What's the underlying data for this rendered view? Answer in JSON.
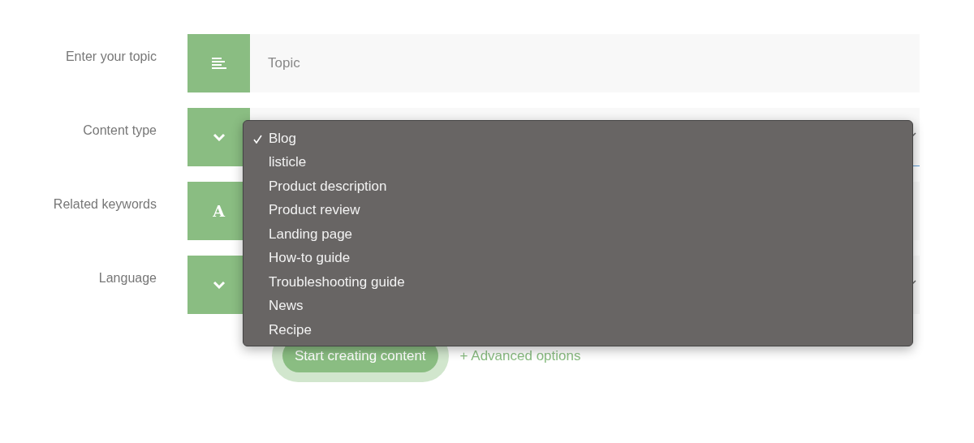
{
  "form": {
    "rows": [
      {
        "label": "Enter your topic",
        "kind": "text",
        "placeholder": "Topic"
      },
      {
        "label": "Content type",
        "kind": "select",
        "focused": true
      },
      {
        "label": "Related keywords",
        "kind": "glyph",
        "glyph": "A"
      },
      {
        "label": "Language",
        "kind": "select",
        "focused": false
      }
    ]
  },
  "dropdown": {
    "options": [
      {
        "label": "Blog",
        "selected": true
      },
      {
        "label": "listicle",
        "selected": false
      },
      {
        "label": "Product description",
        "selected": false
      },
      {
        "label": "Product review",
        "selected": false
      },
      {
        "label": "Landing page",
        "selected": false
      },
      {
        "label": "How-to guide",
        "selected": false
      },
      {
        "label": "Troubleshooting guide",
        "selected": false
      },
      {
        "label": "News",
        "selected": false
      },
      {
        "label": "Recipe",
        "selected": false
      }
    ]
  },
  "actions": {
    "submit": "Start creating content",
    "advanced": "+ Advanced options"
  }
}
